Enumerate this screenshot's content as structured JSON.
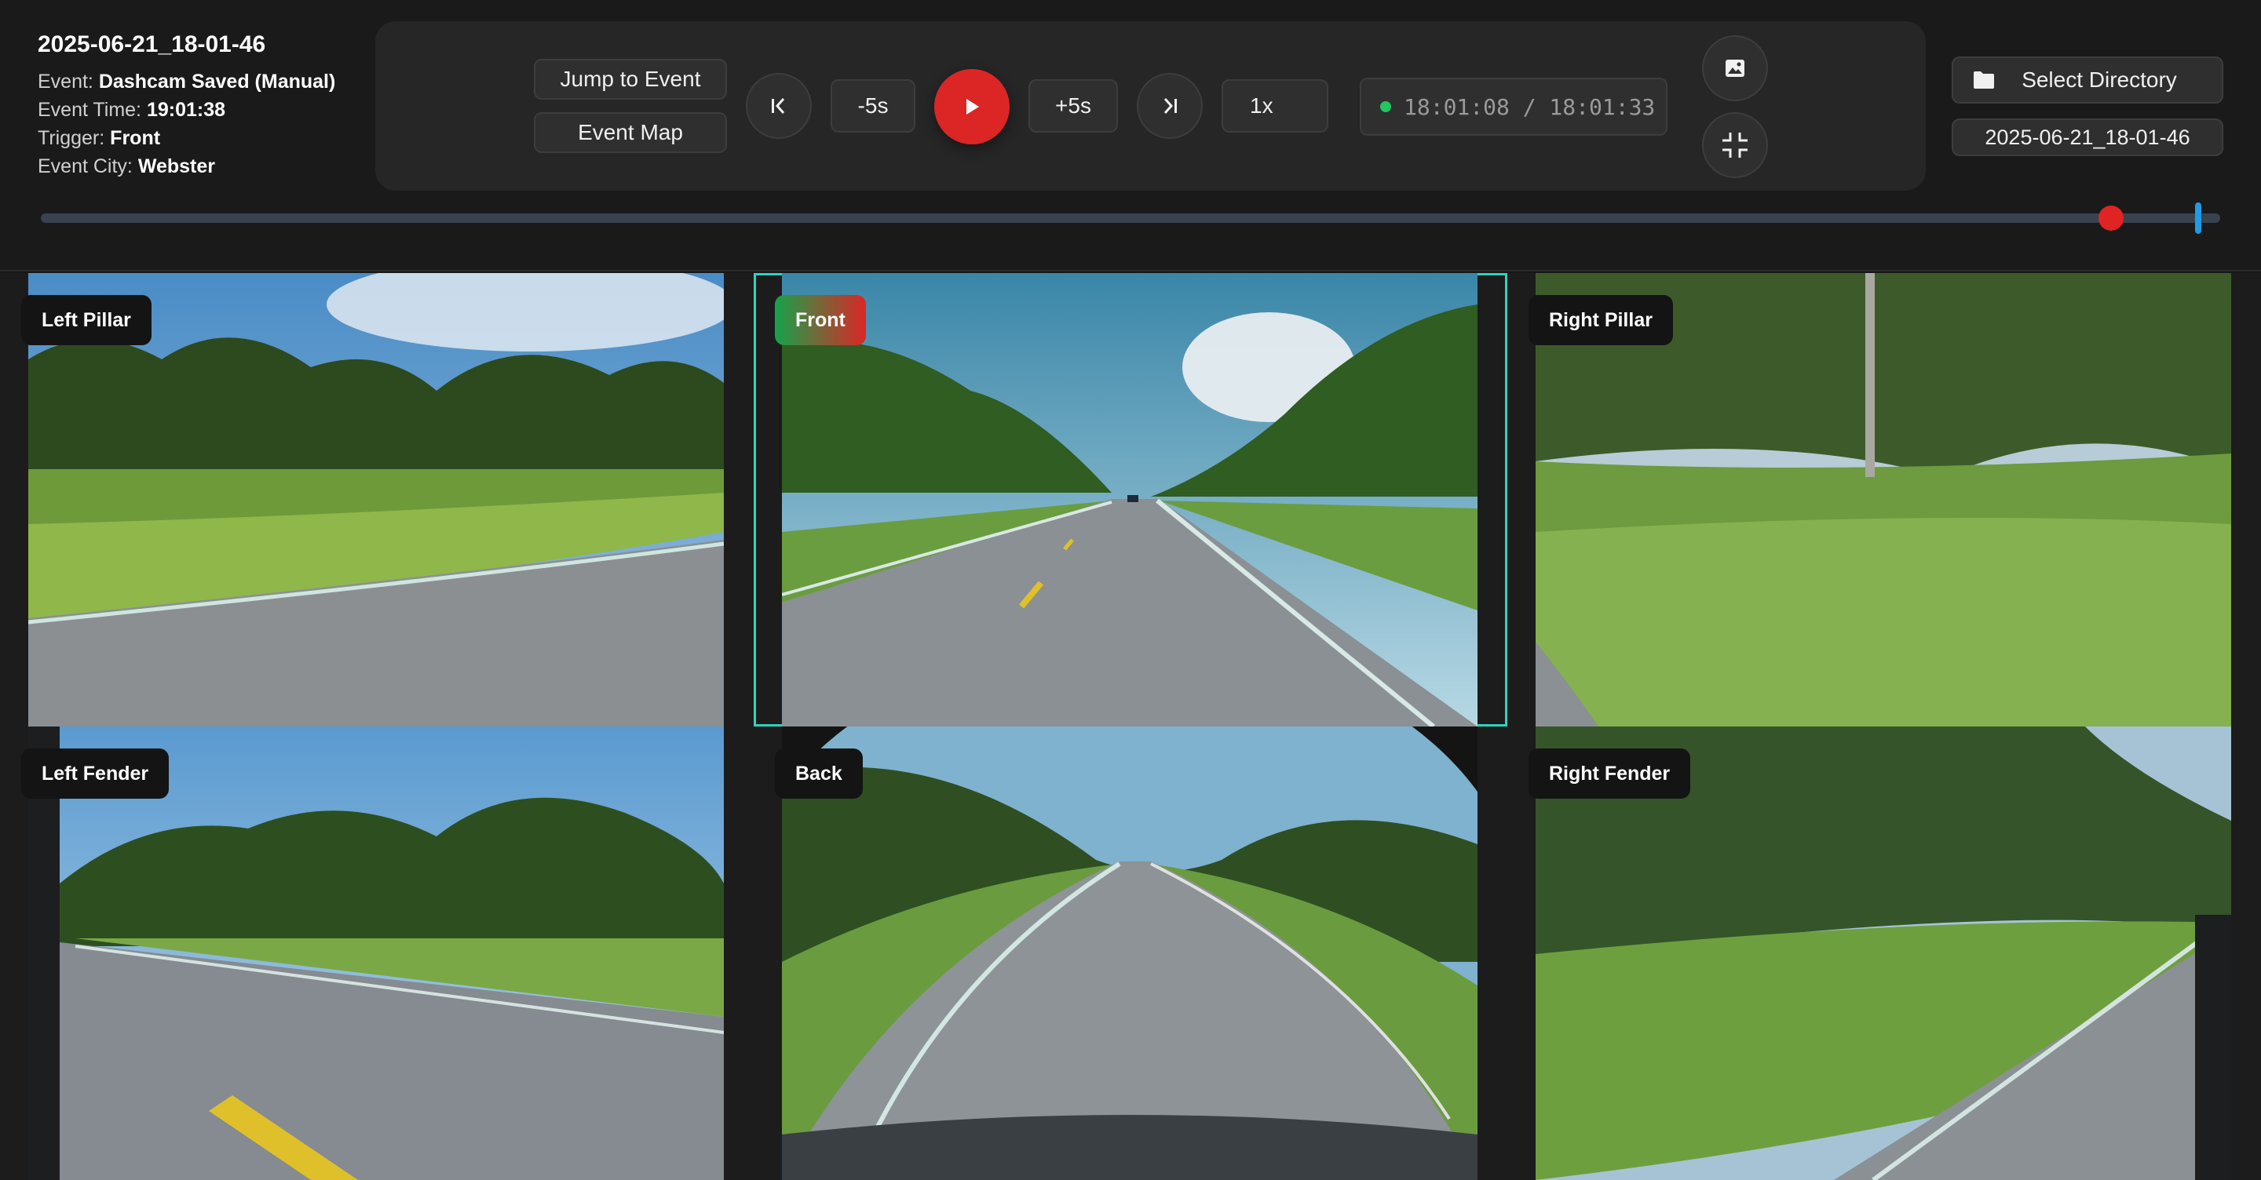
{
  "event": {
    "folder_name": "2025-06-21_18-01-46",
    "event_label": "Event:",
    "event_value": "Dashcam Saved (Manual)",
    "time_label": "Event Time:",
    "time_value": "19:01:38",
    "trigger_label": "Trigger:",
    "trigger_value": "Front",
    "city_label": "Event City:",
    "city_value": "Webster"
  },
  "controls": {
    "jump_to_event": "Jump to Event",
    "event_map": "Event Map",
    "back_5": "-5s",
    "forward_5": "+5s",
    "speed": "1x",
    "time_display": "18:01:08 / 18:01:33",
    "status_color": "#22c55e",
    "play_color": "#dc2626",
    "icons": {
      "skip_back": "skip-back-icon",
      "play": "play-icon",
      "skip_forward": "skip-forward-icon",
      "screenshot": "image-icon",
      "fullscreen": "minimize-icon"
    }
  },
  "directory": {
    "select_label": "Select Directory",
    "current": "2025-06-21_18-01-46",
    "icon": "folder-icon"
  },
  "timeline": {
    "progress": 0.95,
    "event_marker_position": 0.99,
    "playhead_color": "#e02424",
    "marker_color": "#1e9be8"
  },
  "cameras": [
    {
      "id": "left_pillar",
      "label": "Left Pillar"
    },
    {
      "id": "front",
      "label": "Front",
      "active": true
    },
    {
      "id": "right_pillar",
      "label": "Right Pillar"
    },
    {
      "id": "left_fender",
      "label": "Left Fender"
    },
    {
      "id": "back",
      "label": "Back"
    },
    {
      "id": "right_fender",
      "label": "Right Fender"
    }
  ]
}
